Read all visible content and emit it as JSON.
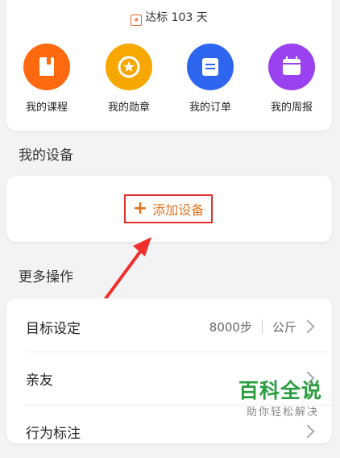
{
  "streak": {
    "text": "达标 103 天",
    "icon": "star-badge-icon"
  },
  "quick_actions": [
    {
      "label": "我的课程",
      "icon": "course-icon",
      "color": "#ff6a10"
    },
    {
      "label": "我的勋章",
      "icon": "medal-icon",
      "color": "#f6a800"
    },
    {
      "label": "我的订单",
      "icon": "order-icon",
      "color": "#2f66f0"
    },
    {
      "label": "我的周报",
      "icon": "weekly-report-icon",
      "color": "#9a42f0"
    }
  ],
  "devices": {
    "title": "我的设备",
    "add_label": "添加设备"
  },
  "operations": {
    "title": "更多操作",
    "rows": [
      {
        "label": "目标设定",
        "steps": "8000步",
        "weight": "公斤"
      },
      {
        "label": "亲友"
      },
      {
        "label": "行为标注"
      }
    ]
  },
  "watermark": {
    "title": "百科全说",
    "subtitle": "助你轻松解决"
  },
  "colors": {
    "accent": "#e07420",
    "highlight_box": "#e0302c",
    "watermark": "#2a9c3f"
  }
}
